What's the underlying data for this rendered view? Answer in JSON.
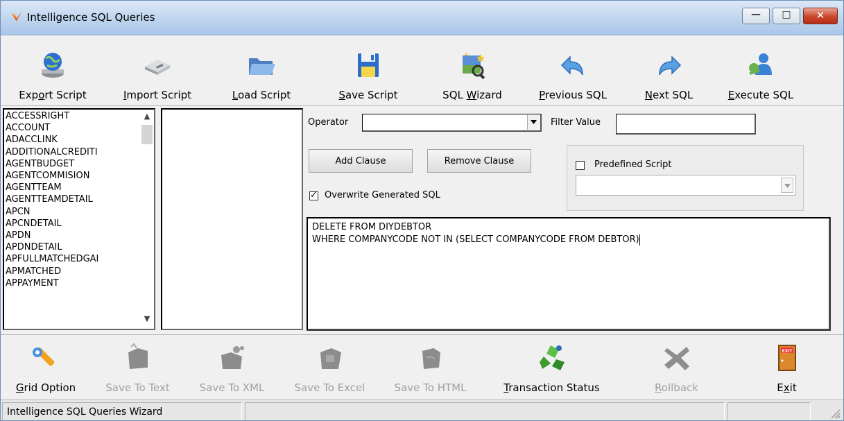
{
  "window": {
    "title": "Intelligence SQL Queries",
    "icon": "flame-logo-icon",
    "controls": {
      "minimize": "—",
      "maximize": "□",
      "close": "✕"
    }
  },
  "toolbar": {
    "buttons": [
      {
        "pre": "Exp",
        "key": "o",
        "post": "rt Script",
        "icon": "globe-drive-icon",
        "enabled": true
      },
      {
        "pre": "",
        "key": "I",
        "post": "mport Script",
        "icon": "drive-icon",
        "enabled": true
      },
      {
        "pre": "",
        "key": "L",
        "post": "oad Script",
        "icon": "folder-open-icon",
        "enabled": true
      },
      {
        "pre": "",
        "key": "S",
        "post": "ave Script",
        "icon": "floppy-disk-icon",
        "enabled": true
      },
      {
        "pre": "SQL ",
        "key": "W",
        "post": "izard",
        "icon": "wizard-icon",
        "enabled": true
      },
      {
        "pre": "",
        "key": "P",
        "post": "revious SQL",
        "icon": "arrow-back-icon",
        "enabled": true
      },
      {
        "pre": "",
        "key": "N",
        "post": "ext SQL",
        "icon": "arrow-forward-icon",
        "enabled": true
      },
      {
        "pre": "",
        "key": "E",
        "post": "xecute SQL",
        "icon": "execute-user-icon",
        "enabled": true
      }
    ]
  },
  "tables": [
    "ACCESSRIGHT",
    "ACCOUNT",
    "ADACCLINK",
    "ADDITIONALCREDITI",
    "AGENTBUDGET",
    "AGENTCOMMISION",
    "AGENTTEAM",
    "AGENTTEAMDETAIL",
    "APCN",
    "APCNDETAIL",
    "APDN",
    "APDNDETAIL",
    "APFULLMATCHEDGAI",
    "APMATCHED",
    "APPAYMENT"
  ],
  "filter": {
    "operator_label": "Operator",
    "operator_value": "",
    "filter_value_label": "Filter Value",
    "filter_value": ""
  },
  "clauses": {
    "add_label": "Add Clause",
    "remove_label": "Remove Clause",
    "overwrite_label": "Overwrite Generated SQL",
    "overwrite_checked": true
  },
  "predefined": {
    "label": "Predefined Script",
    "checked": false,
    "value": ""
  },
  "sql": {
    "line1": "DELETE FROM DIYDEBTOR",
    "line2": "WHERE COMPANYCODE NOT IN (SELECT COMPANYCODE FROM DEBTOR)"
  },
  "bottom_toolbar": {
    "buttons": [
      {
        "pre": "",
        "key": "G",
        "post": "rid Option",
        "icon": "wrench-icon",
        "enabled": true
      },
      {
        "pre": "Save To Text",
        "key": "",
        "post": "",
        "icon": "save-text-icon",
        "enabled": false
      },
      {
        "pre": "Save To XML",
        "key": "",
        "post": "",
        "icon": "save-xml-icon",
        "enabled": false
      },
      {
        "pre": "Save To Excel",
        "key": "",
        "post": "",
        "icon": "save-excel-icon",
        "enabled": false
      },
      {
        "pre": "Save To HTML",
        "key": "",
        "post": "",
        "icon": "save-html-icon",
        "enabled": false
      },
      {
        "pre": "",
        "key": "T",
        "post": "ransaction Status",
        "icon": "transaction-recycle-icon",
        "enabled": true
      },
      {
        "pre": "",
        "key": "R",
        "post": "ollback",
        "icon": "rollback-x-icon",
        "enabled": false
      },
      {
        "pre": "E",
        "key": "x",
        "post": "it",
        "icon": "exit-door-icon",
        "enabled": true
      }
    ]
  },
  "status": {
    "text": "Intelligence SQL Queries Wizard"
  },
  "colors": {
    "title_gradient": "#bcd3ee",
    "close_button": "#c8452b",
    "disabled_text": "#a0a0a0"
  }
}
